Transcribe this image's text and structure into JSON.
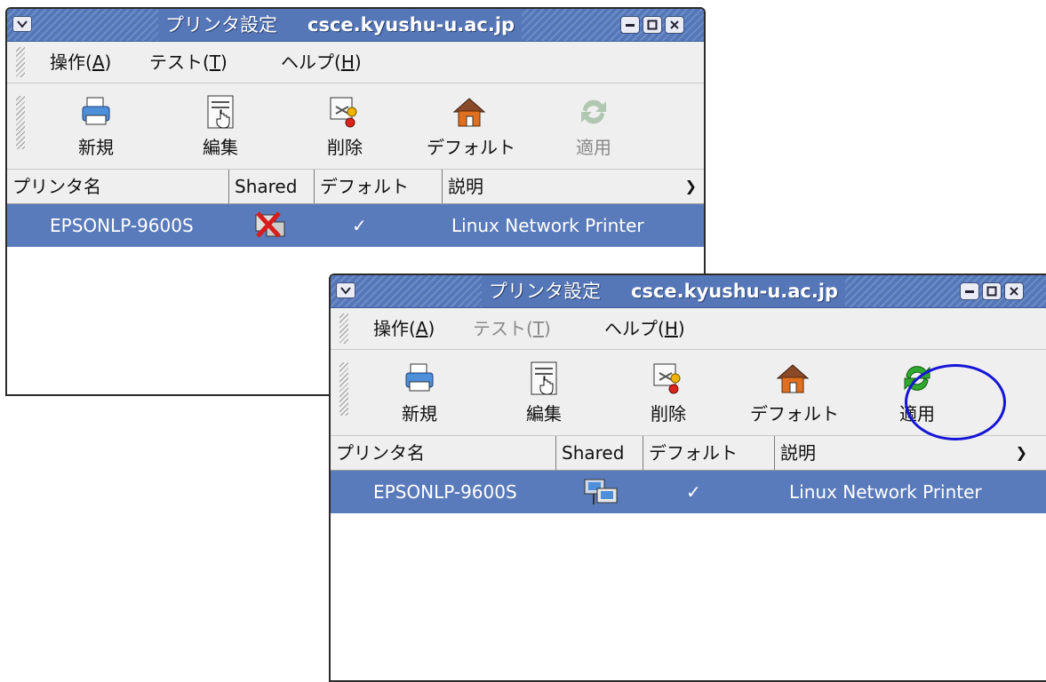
{
  "windows": [
    {
      "title_prefix": "プリンタ設定",
      "title_host": "csce.kyushu-u.ac.jp",
      "menu": [
        {
          "label": "操作(",
          "mnemonic": "A",
          "suffix": ")",
          "disabled": false
        },
        {
          "label": "テスト(",
          "mnemonic": "T",
          "suffix": ")",
          "disabled": false
        },
        {
          "label": "ヘルプ(",
          "mnemonic": "H",
          "suffix": ")",
          "disabled": false
        }
      ],
      "toolbar": [
        {
          "label": "新規",
          "icon": "printer-new-icon",
          "disabled": false
        },
        {
          "label": "編集",
          "icon": "edit-document-icon",
          "disabled": false
        },
        {
          "label": "削除",
          "icon": "delete-scissors-icon",
          "disabled": false
        },
        {
          "label": "デフォルト",
          "icon": "default-home-icon",
          "disabled": false
        },
        {
          "label": "適用",
          "icon": "apply-refresh-icon",
          "disabled": true
        }
      ],
      "columns": [
        "プリンタ名",
        "Shared",
        "デフォルト",
        "説明"
      ],
      "rows": [
        {
          "name": "EPSONLP-9600S",
          "shared": false,
          "shared_icon": "not-shared-icon",
          "default": "✓",
          "description": "Linux Network Printer"
        }
      ]
    },
    {
      "title_prefix": "プリンタ設定",
      "title_host": "csce.kyushu-u.ac.jp",
      "menu": [
        {
          "label": "操作(",
          "mnemonic": "A",
          "suffix": ")",
          "disabled": false
        },
        {
          "label": "テスト(",
          "mnemonic": "T",
          "suffix": ")",
          "disabled": true
        },
        {
          "label": "ヘルプ(",
          "mnemonic": "H",
          "suffix": ")",
          "disabled": false
        }
      ],
      "toolbar": [
        {
          "label": "新規",
          "icon": "printer-new-icon",
          "disabled": false
        },
        {
          "label": "編集",
          "icon": "edit-document-icon",
          "disabled": false
        },
        {
          "label": "削除",
          "icon": "delete-scissors-icon",
          "disabled": false
        },
        {
          "label": "デフォルト",
          "icon": "default-home-icon",
          "disabled": false
        },
        {
          "label": "適用",
          "icon": "apply-refresh-icon",
          "disabled": false
        }
      ],
      "columns": [
        "プリンタ名",
        "Shared",
        "デフォルト",
        "説明"
      ],
      "rows": [
        {
          "name": "EPSONLP-9600S",
          "shared": true,
          "shared_icon": "shared-network-icon",
          "default": "✓",
          "description": "Linux Network Printer"
        }
      ]
    }
  ],
  "colors": {
    "titlebar": "#5577b8",
    "selection": "#5a7bbb",
    "highlight_circle": "#1414d6"
  }
}
